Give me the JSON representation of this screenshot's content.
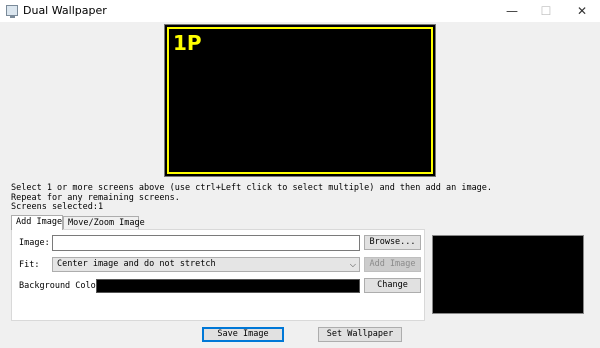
{
  "window": {
    "title": "Dual Wallpaper",
    "minimize_glyph": "—",
    "maximize_glyph": "☐",
    "close_glyph": "✕"
  },
  "preview": {
    "screen_label": "1P",
    "border_color": "#ffff00"
  },
  "instructions": {
    "line1": "Select 1 or more screens above (use ctrl+Left click to select multiple) and then add an image.",
    "line2": "Repeat for any remaining screens.",
    "line3": "Screens selected:1"
  },
  "tabs": [
    {
      "label": "Add Image",
      "active": true
    },
    {
      "label": "Move/Zoom Image",
      "active": false
    }
  ],
  "form": {
    "image_label": "Image:",
    "image_value": "",
    "browse_label": "Browse...",
    "fit_label": "Fit:",
    "fit_selected": "Center image and do not stretch",
    "add_image_label": "Add Image",
    "bg_color_label": "Background Color:",
    "bg_color_value": "#000000",
    "change_label": "Change"
  },
  "actions": {
    "save_label": "Save Image",
    "set_wallpaper_label": "Set Wallpaper"
  }
}
